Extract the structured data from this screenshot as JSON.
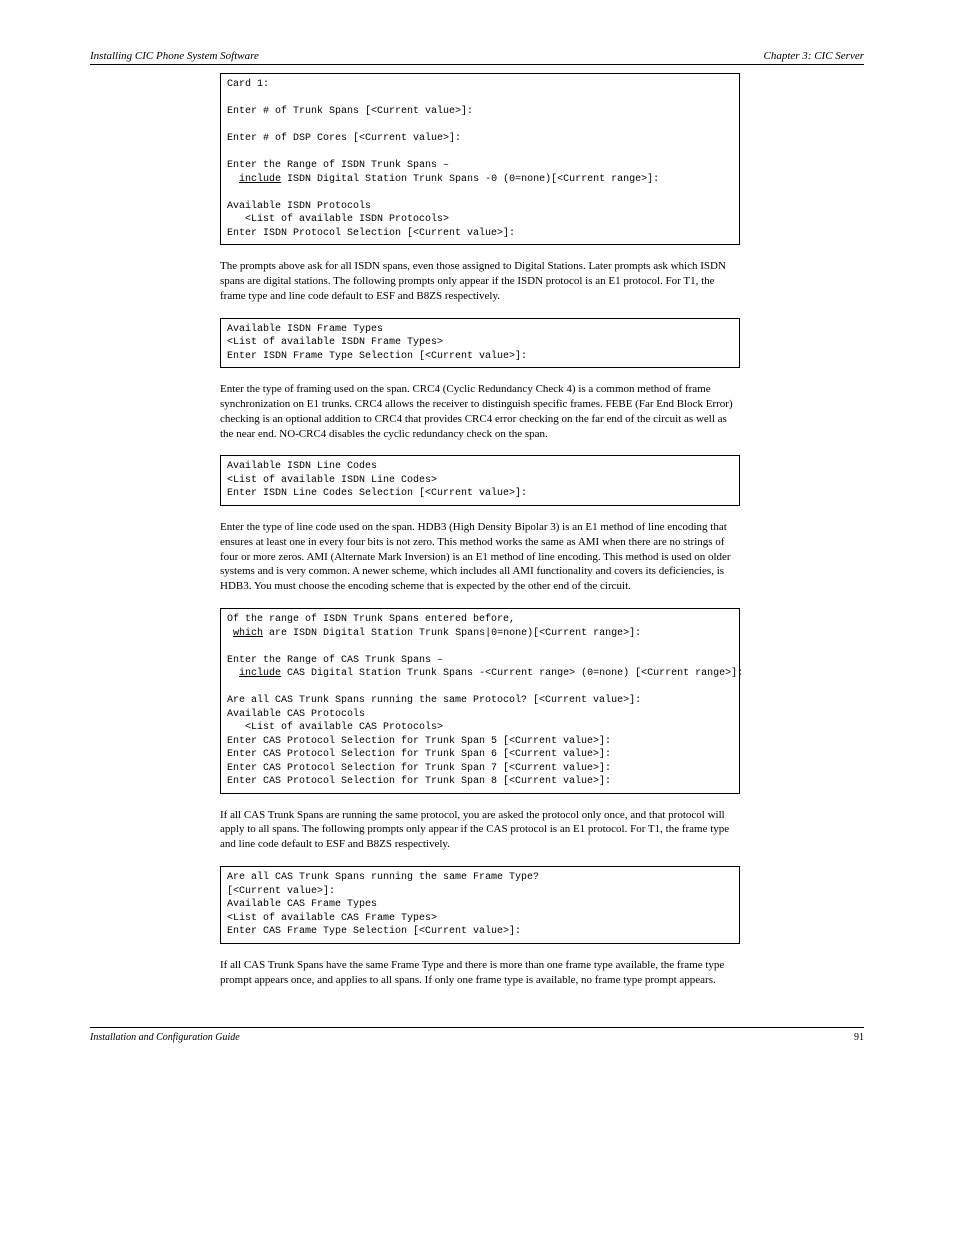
{
  "header": {
    "left": "Installing CIC Phone System Software",
    "right": "Chapter 3: CIC Server"
  },
  "label_box1": "",
  "box1": {
    "l1": "Card 1:",
    "blank1": "",
    "l2": "Enter # of Trunk Spans [<Current value>]:",
    "blank2": "",
    "l3": "Enter # of DSP Cores [<Current value>]:",
    "blank3": "",
    "l4": "Enter the Range of ISDN Trunk Spans –",
    "l5_a": "  ",
    "l5_u": "include",
    "l5_b": " ISDN Digital Station Trunk Spans -0 (0=none)[<Current range>]:",
    "blank4": "",
    "l6": "Available ISDN Protocols",
    "l7": "   <List of available ISDN Protocols>",
    "l8": "Enter ISDN Protocol Selection [<Current value>]:"
  },
  "para1": "The prompts above ask for all ISDN spans, even those assigned to Digital Stations. Later prompts ask which ISDN spans are digital stations. The following prompts only appear if the ISDN protocol is an E1 protocol. For T1, the frame type and line code default to ESF and B8ZS respectively.",
  "box2": {
    "l1": "Available ISDN Frame Types",
    "l2": "<List of available ISDN Frame Types>",
    "l3": "Enter ISDN Frame Type Selection [<Current value>]:"
  },
  "para2": "Enter the type of framing used on the span. CRC4 (Cyclic Redundancy Check 4) is a common method of frame synchronization on E1 trunks. CRC4 allows the receiver to distinguish specific frames. FEBE (Far End Block Error) checking is an optional addition to CRC4 that provides CRC4 error checking on the far end of the circuit as well as the near end. NO-CRC4 disables the cyclic redundancy check on the span.",
  "box3": {
    "l1": "Available ISDN Line Codes",
    "l2": "<List of available ISDN Line Codes>",
    "l3": "Enter ISDN Line Codes Selection [<Current value>]:"
  },
  "para3": "Enter the type of line code used on the span. HDB3 (High Density Bipolar 3) is an E1 method of line encoding that ensures at least one in every four bits is not zero. This method works the same as AMI when there are no strings of four or more zeros. AMI (Alternate Mark Inversion) is an E1 method of line encoding. This method is used on older systems and is very common. A newer scheme, which includes all AMI functionality and covers its deficiencies, is HDB3. You must choose the encoding scheme that is expected by the other end of the circuit.",
  "box4": {
    "l1": "Of the range of ISDN Trunk Spans entered before,",
    "l2_a": " ",
    "l2_u": "which",
    "l2_b": " are ISDN Digital Station Trunk Spans|0=none)[<Current range>]:",
    "blank1": "",
    "l3": "Enter the Range of CAS Trunk Spans –",
    "l4_a": "  ",
    "l4_u": "include",
    "l4_b": " CAS Digital Station Trunk Spans -<Current range> (0=none) [<Current range>]:",
    "blank2": "",
    "l5": "Are all CAS Trunk Spans running the same Protocol? [<Current value>]:",
    "l6": "Available CAS Protocols",
    "l7": "   <List of available CAS Protocols>",
    "l8": "Enter CAS Protocol Selection for Trunk Span 5 [<Current value>]:",
    "l9": "Enter CAS Protocol Selection for Trunk Span 6 [<Current value>]:",
    "l10": "Enter CAS Protocol Selection for Trunk Span 7 [<Current value>]:",
    "l11": "Enter CAS Protocol Selection for Trunk Span 8 [<Current value>]:"
  },
  "para4": "If all CAS Trunk Spans are running the same protocol, you are asked the protocol only once, and that protocol will apply to all spans. The following prompts only appear if the CAS protocol is an E1 protocol. For T1, the frame type and line code default to ESF and B8ZS respectively.",
  "box5": {
    "l1": "Are all CAS Trunk Spans running the same Frame Type?",
    "l2": "[<Current value>]:",
    "l3": "Available CAS Frame Types",
    "l4": "<List of available CAS Frame Types>",
    "l5": "Enter CAS Frame Type Selection [<Current value>]:"
  },
  "para5": "If all CAS Trunk Spans have the same Frame Type and there is more than one frame type available, the frame type prompt appears once, and applies to all spans. If only one frame type is available, no frame type prompt appears.",
  "footer": {
    "left": "Installation and Configuration Guide",
    "right": "91"
  }
}
